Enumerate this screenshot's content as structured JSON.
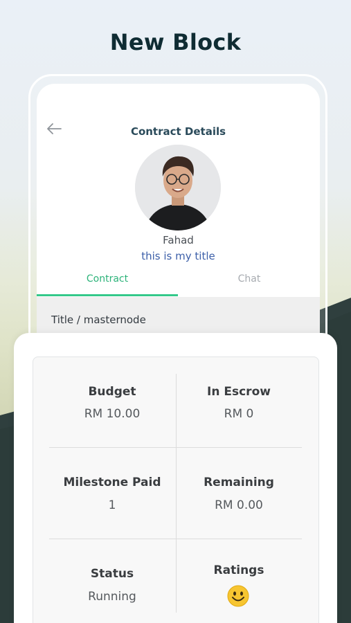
{
  "headline": "New Block",
  "screen": {
    "title": "Contract Details",
    "user": {
      "name": "Fahad",
      "title": "this is my title"
    },
    "tabs": [
      {
        "label": "Contract",
        "active": true
      },
      {
        "label": "Chat",
        "active": false
      }
    ],
    "contract_title": "Title / masternode"
  },
  "details": {
    "budget": {
      "label": "Budget",
      "value": "RM 10.00"
    },
    "escrow": {
      "label": "In Escrow",
      "value": "RM 0"
    },
    "milestone": {
      "label": "Milestone Paid",
      "value": "1"
    },
    "remaining": {
      "label": "Remaining",
      "value": "RM 0.00"
    },
    "status": {
      "label": "Status",
      "value": "Running"
    },
    "ratings": {
      "label": "Ratings",
      "icon": "smiley-icon"
    }
  },
  "colors": {
    "accent_green": "#34c98a",
    "title_blue": "#3c5fa8",
    "headline": "#0f2c33",
    "hill_dark": "#2f3f3e"
  }
}
